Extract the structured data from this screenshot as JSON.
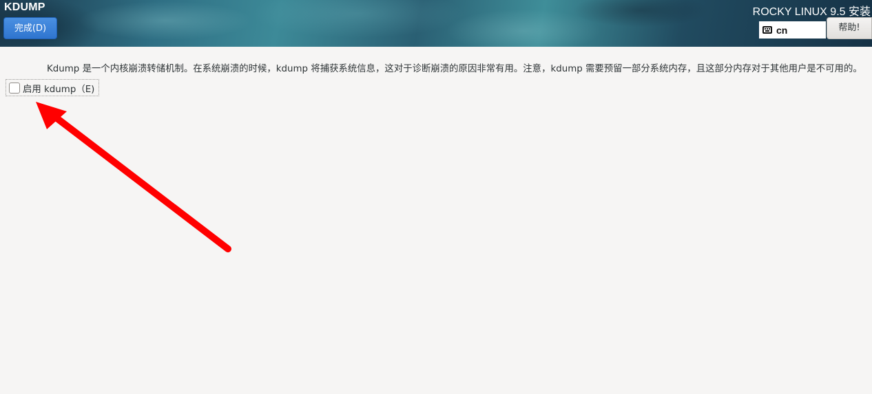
{
  "header": {
    "spoke_title": "KDUMP",
    "done_button_label": "完成(D)",
    "product_title": "ROCKY LINUX 9.5 安装",
    "keyboard_layout": "cn",
    "keyboard_icon": "keyboard-icon",
    "help_button_label": "帮助!"
  },
  "main": {
    "description": "Kdump 是一个内核崩溃转储机制。在系统崩溃的时候，kdump 将捕获系统信息，这对于诊断崩溃的原因非常有用。注意，kdump 需要预留一部分系统内存，且这部分内存对于其他用户是不可用的。",
    "enable_kdump": {
      "label": "启用 kdump（E)",
      "checked": false
    }
  },
  "colors": {
    "primary_button": "#3584e4",
    "background": "#f6f5f4",
    "annotation_arrow": "#ff0000"
  }
}
